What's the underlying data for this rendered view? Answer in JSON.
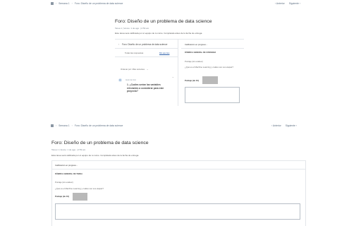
{
  "top": {
    "breadcrumb": [
      "Semana 1",
      "Foro: Diseño de un problema de data science"
    ],
    "nav_prev": "‹ Anterior",
    "nav_next": "Siguiente ›",
    "title": "Foro: Diseño de un problema de data science",
    "meta": "Tarea 1 | Vence: 1 de ago. | 2:59 am",
    "note": "Este tarea sera calificada por el equipo de tu curso. Completala antes de la fecha de entrega.",
    "panel_title": "Foro: Diseño de un problema de data science",
    "tab_all": "Todas las respuestas",
    "tab_mine": "Mis aportes",
    "sort_label": "Ordenar por: Más recientes",
    "post_author": "Autor del foro",
    "post_question": "1. ¿Cuáles serían las variables relevantes a considerar para este proyecto?",
    "grading_label": "Calificación en progreso...",
    "rubric_label": "RÚBRICA GENERAL DE CONSIGNA",
    "score_label": "Puntaje (sin evaluar)",
    "question_text": "¿Qué es el Machine Learning y cuáles son sus etapas?",
    "rating_label": "Puntaje (de 10)"
  },
  "bottom": {
    "breadcrumb": [
      "Semana 1",
      "Foro: Diseño de un problema de data science"
    ],
    "nav_prev": "‹ Anterior",
    "nav_next": "Siguiente ›",
    "title": "Foro: Diseño de un problema de data science",
    "meta": "Tarea 1 | Vence: 1 de ago. | 2:59 am",
    "note": "Esta tarea será calificada por el equipo de tu curso. Complétala antes de la fecha de entrega.",
    "grading_label": "Calificación en progreso...",
    "rubric_label": "RÚBRICA GENERAL DE TAREA",
    "score_label": "Puntaje (sin evaluar)",
    "question_text": "¿Qué es el Machine Learning y cuáles son sus etapas?",
    "rating_label": "Puntaje (de 10)"
  }
}
